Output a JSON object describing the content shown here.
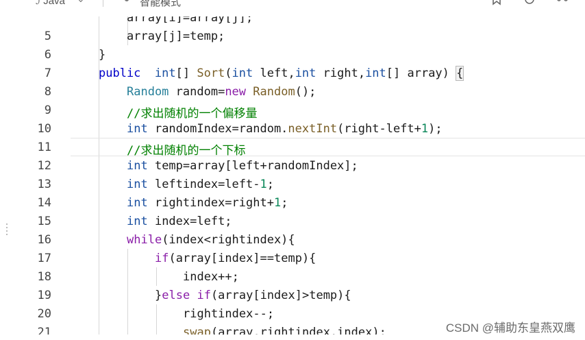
{
  "toolbar": {
    "language": "Java",
    "mode": "智能模式"
  },
  "lines": [
    {
      "num": "",
      "segments": [
        [
          "",
          "array[i]=array[j];"
        ]
      ]
    },
    {
      "num": "5",
      "segments": [
        [
          "",
          "array[j]=temp;"
        ]
      ]
    },
    {
      "num": "6",
      "segments": [
        [
          "",
          "}"
        ]
      ]
    },
    {
      "num": "7",
      "segments": [
        [
          "kw",
          "public"
        ],
        [
          "",
          "  "
        ],
        [
          "ty",
          "int"
        ],
        [
          "",
          "[] "
        ],
        [
          "fn",
          "Sort"
        ],
        [
          "",
          "("
        ],
        [
          "ty",
          "int"
        ],
        [
          "",
          " left,"
        ],
        [
          "ty",
          "int"
        ],
        [
          "",
          " right,"
        ],
        [
          "ty",
          "int"
        ],
        [
          "",
          "[] array) "
        ],
        [
          "br",
          "{"
        ]
      ]
    },
    {
      "num": "8",
      "segments": [
        [
          "tn",
          "Random"
        ],
        [
          "",
          " random="
        ],
        [
          "kw2",
          "new"
        ],
        [
          "",
          " "
        ],
        [
          "fn",
          "Random"
        ],
        [
          "",
          "();"
        ]
      ]
    },
    {
      "num": "9",
      "segments": [
        [
          "cm",
          "//求出随机的一个偏移量"
        ]
      ]
    },
    {
      "num": "10",
      "segments": [
        [
          "ty",
          "int"
        ],
        [
          "",
          " randomIndex=random."
        ],
        [
          "fn",
          "nextInt"
        ],
        [
          "",
          "(right-left+"
        ],
        [
          "num",
          "1"
        ],
        [
          "",
          ");"
        ]
      ]
    },
    {
      "num": "11",
      "segments": [
        [
          "cm",
          "//求出随机的一个下标"
        ]
      ]
    },
    {
      "num": "12",
      "segments": [
        [
          "ty",
          "int"
        ],
        [
          "",
          " temp=array[left+randomIndex];"
        ]
      ]
    },
    {
      "num": "13",
      "segments": [
        [
          "ty",
          "int"
        ],
        [
          "",
          " leftindex=left-"
        ],
        [
          "num",
          "1"
        ],
        [
          "",
          ";"
        ]
      ]
    },
    {
      "num": "14",
      "segments": [
        [
          "ty",
          "int"
        ],
        [
          "",
          " rightindex=right+"
        ],
        [
          "num",
          "1"
        ],
        [
          "",
          ";"
        ]
      ]
    },
    {
      "num": "15",
      "segments": [
        [
          "ty",
          "int"
        ],
        [
          "",
          " index=left;"
        ]
      ]
    },
    {
      "num": "16",
      "segments": [
        [
          "kw2",
          "while"
        ],
        [
          "",
          "(index<rightindex){"
        ]
      ]
    },
    {
      "num": "17",
      "segments": [
        [
          "kw2",
          "if"
        ],
        [
          "",
          "(array[index]==temp){"
        ]
      ]
    },
    {
      "num": "18",
      "segments": [
        [
          "",
          "index++;"
        ]
      ]
    },
    {
      "num": "19",
      "segments": [
        [
          "",
          "}"
        ],
        [
          "kw2",
          "else"
        ],
        [
          "",
          " "
        ],
        [
          "kw2",
          "if"
        ],
        [
          "",
          "(array[index]>temp){"
        ]
      ]
    },
    {
      "num": "20",
      "segments": [
        [
          "",
          "rightindex--;"
        ]
      ]
    },
    {
      "num": "21",
      "segments": [
        [
          "fn",
          "swap"
        ],
        [
          "",
          "(array,rightindex,index);"
        ]
      ]
    }
  ],
  "watermark": "CSDN @辅助东皇燕双鹰"
}
